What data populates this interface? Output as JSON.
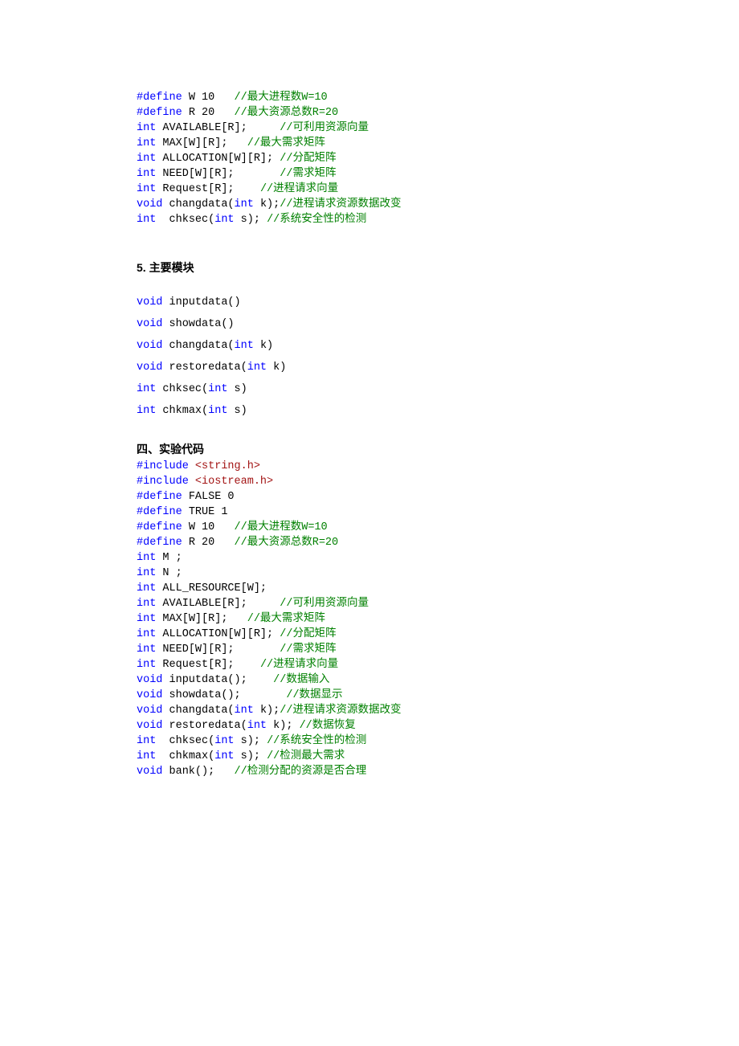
{
  "block1": {
    "lines": [
      [
        {
          "cls": "kw",
          "t": "#define"
        },
        {
          "cls": "txt",
          "t": " W 10   "
        },
        {
          "cls": "cmt",
          "t": "//最大进程数W=10"
        }
      ],
      [
        {
          "cls": "kw",
          "t": "#define"
        },
        {
          "cls": "txt",
          "t": " R 20   "
        },
        {
          "cls": "cmt",
          "t": "//最大资源总数R=20"
        }
      ],
      [
        {
          "cls": "typ",
          "t": "int"
        },
        {
          "cls": "txt",
          "t": " AVAILABLE[R];     "
        },
        {
          "cls": "cmt",
          "t": "//可利用资源向量"
        }
      ],
      [
        {
          "cls": "typ",
          "t": "int"
        },
        {
          "cls": "txt",
          "t": " MAX[W][R];   "
        },
        {
          "cls": "cmt",
          "t": "//最大需求矩阵"
        }
      ],
      [
        {
          "cls": "typ",
          "t": "int"
        },
        {
          "cls": "txt",
          "t": " ALLOCATION[W][R]; "
        },
        {
          "cls": "cmt",
          "t": "//分配矩阵"
        }
      ],
      [
        {
          "cls": "typ",
          "t": "int"
        },
        {
          "cls": "txt",
          "t": " NEED[W][R];       "
        },
        {
          "cls": "cmt",
          "t": "//需求矩阵"
        }
      ],
      [
        {
          "cls": "typ",
          "t": "int"
        },
        {
          "cls": "txt",
          "t": " Request[R];    "
        },
        {
          "cls": "cmt",
          "t": "//进程请求向量"
        }
      ],
      [
        {
          "cls": "typ",
          "t": "void"
        },
        {
          "cls": "txt",
          "t": " changdata("
        },
        {
          "cls": "typ",
          "t": "int"
        },
        {
          "cls": "txt",
          "t": " k);"
        },
        {
          "cls": "cmt",
          "t": "//进程请求资源数据改变"
        }
      ],
      [
        {
          "cls": "typ",
          "t": "int"
        },
        {
          "cls": "txt",
          "t": "  chksec("
        },
        {
          "cls": "typ",
          "t": "int"
        },
        {
          "cls": "txt",
          "t": " s); "
        },
        {
          "cls": "cmt",
          "t": "//系统安全性的检测"
        }
      ]
    ]
  },
  "heading1": "5.    主要模块",
  "block2": {
    "lines": [
      [
        {
          "cls": "typ",
          "t": "void"
        },
        {
          "cls": "txt",
          "t": " inputdata()"
        }
      ],
      [
        {
          "cls": "typ",
          "t": "void"
        },
        {
          "cls": "txt",
          "t": " showdata()"
        }
      ],
      [
        {
          "cls": "typ",
          "t": "void"
        },
        {
          "cls": "txt",
          "t": " changdata("
        },
        {
          "cls": "typ",
          "t": "int"
        },
        {
          "cls": "txt",
          "t": " k)"
        }
      ],
      [
        {
          "cls": "typ",
          "t": "void"
        },
        {
          "cls": "txt",
          "t": " restoredata("
        },
        {
          "cls": "typ",
          "t": "int"
        },
        {
          "cls": "txt",
          "t": " k)"
        }
      ],
      [
        {
          "cls": "typ",
          "t": "int"
        },
        {
          "cls": "txt",
          "t": " chksec("
        },
        {
          "cls": "typ",
          "t": "int"
        },
        {
          "cls": "txt",
          "t": " s)"
        }
      ],
      [
        {
          "cls": "typ",
          "t": "int"
        },
        {
          "cls": "txt",
          "t": " chkmax("
        },
        {
          "cls": "typ",
          "t": "int"
        },
        {
          "cls": "txt",
          "t": " s)"
        }
      ]
    ],
    "lineHeight": 27
  },
  "heading2": "四、实验代码",
  "block3": {
    "lines": [
      [
        {
          "cls": "kw",
          "t": "#include"
        },
        {
          "cls": "txt",
          "t": " "
        },
        {
          "cls": "str",
          "t": "<string.h>"
        }
      ],
      [
        {
          "cls": "kw",
          "t": "#include"
        },
        {
          "cls": "txt",
          "t": " "
        },
        {
          "cls": "str",
          "t": "<iostream.h>"
        }
      ],
      [
        {
          "cls": "kw",
          "t": "#define"
        },
        {
          "cls": "txt",
          "t": " FALSE 0"
        }
      ],
      [
        {
          "cls": "kw",
          "t": "#define"
        },
        {
          "cls": "txt",
          "t": " TRUE 1"
        }
      ],
      [
        {
          "cls": "kw",
          "t": "#define"
        },
        {
          "cls": "txt",
          "t": " W 10   "
        },
        {
          "cls": "cmt",
          "t": "//最大进程数W=10"
        }
      ],
      [
        {
          "cls": "kw",
          "t": "#define"
        },
        {
          "cls": "txt",
          "t": " R 20   "
        },
        {
          "cls": "cmt",
          "t": "//最大资源总数R=20"
        }
      ],
      [
        {
          "cls": "typ",
          "t": "int"
        },
        {
          "cls": "txt",
          "t": " M ;"
        }
      ],
      [
        {
          "cls": "typ",
          "t": "int"
        },
        {
          "cls": "txt",
          "t": " N ;"
        }
      ],
      [
        {
          "cls": "typ",
          "t": "int"
        },
        {
          "cls": "txt",
          "t": " ALL_RESOURCE[W];"
        }
      ],
      [
        {
          "cls": "typ",
          "t": "int"
        },
        {
          "cls": "txt",
          "t": " AVAILABLE[R];     "
        },
        {
          "cls": "cmt",
          "t": "//可利用资源向量"
        }
      ],
      [
        {
          "cls": "typ",
          "t": "int"
        },
        {
          "cls": "txt",
          "t": " MAX[W][R];   "
        },
        {
          "cls": "cmt",
          "t": "//最大需求矩阵"
        }
      ],
      [
        {
          "cls": "typ",
          "t": "int"
        },
        {
          "cls": "txt",
          "t": " ALLOCATION[W][R]; "
        },
        {
          "cls": "cmt",
          "t": "//分配矩阵"
        }
      ],
      [
        {
          "cls": "typ",
          "t": "int"
        },
        {
          "cls": "txt",
          "t": " NEED[W][R];       "
        },
        {
          "cls": "cmt",
          "t": "//需求矩阵"
        }
      ],
      [
        {
          "cls": "typ",
          "t": "int"
        },
        {
          "cls": "txt",
          "t": " Request[R];    "
        },
        {
          "cls": "cmt",
          "t": "//进程请求向量"
        }
      ],
      [
        {
          "cls": "typ",
          "t": "void"
        },
        {
          "cls": "txt",
          "t": " inputdata();    "
        },
        {
          "cls": "cmt",
          "t": "//数据输入"
        }
      ],
      [
        {
          "cls": "typ",
          "t": "void"
        },
        {
          "cls": "txt",
          "t": " showdata();       "
        },
        {
          "cls": "cmt",
          "t": "//数据显示"
        }
      ],
      [
        {
          "cls": "typ",
          "t": "void"
        },
        {
          "cls": "txt",
          "t": " changdata("
        },
        {
          "cls": "typ",
          "t": "int"
        },
        {
          "cls": "txt",
          "t": " k);"
        },
        {
          "cls": "cmt",
          "t": "//进程请求资源数据改变"
        }
      ],
      [
        {
          "cls": "typ",
          "t": "void"
        },
        {
          "cls": "txt",
          "t": " restoredata("
        },
        {
          "cls": "typ",
          "t": "int"
        },
        {
          "cls": "txt",
          "t": " k); "
        },
        {
          "cls": "cmt",
          "t": "//数据恢复"
        }
      ],
      [
        {
          "cls": "typ",
          "t": "int"
        },
        {
          "cls": "txt",
          "t": "  chksec("
        },
        {
          "cls": "typ",
          "t": "int"
        },
        {
          "cls": "txt",
          "t": " s); "
        },
        {
          "cls": "cmt",
          "t": "//系统安全性的检测"
        }
      ],
      [
        {
          "cls": "typ",
          "t": "int"
        },
        {
          "cls": "txt",
          "t": "  chkmax("
        },
        {
          "cls": "typ",
          "t": "int"
        },
        {
          "cls": "txt",
          "t": " s); "
        },
        {
          "cls": "cmt",
          "t": "//检测最大需求"
        }
      ],
      [
        {
          "cls": "typ",
          "t": "void"
        },
        {
          "cls": "txt",
          "t": " bank();   "
        },
        {
          "cls": "cmt",
          "t": "//检测分配的资源是否合理"
        }
      ]
    ]
  }
}
